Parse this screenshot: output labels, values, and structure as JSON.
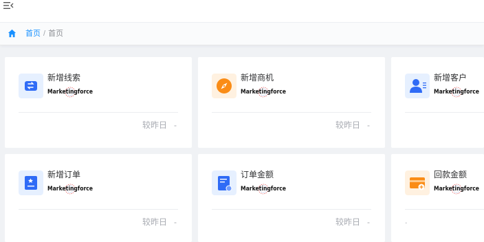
{
  "breadcrumb": {
    "home": "首页",
    "separator": "/",
    "current": "首页"
  },
  "logo_text": "Marketingforce",
  "colors": {
    "accent": "#1890ff",
    "blue_tile": "#e6f0ff",
    "orange_tile": "#fff1e0",
    "orange": "#fa8c16",
    "blue": "#2f6bf6"
  },
  "cards": [
    {
      "title": "新增线索",
      "compare_label": "较昨日",
      "compare_value": "-",
      "icon": "clue-icon"
    },
    {
      "title": "新增商机",
      "compare_label": "较昨日",
      "compare_value": "-",
      "icon": "compass-icon"
    },
    {
      "title": "新增客户",
      "compare_label": "",
      "compare_value": "",
      "icon": "customer-icon"
    },
    {
      "title": "新增订单",
      "compare_label": "较昨日",
      "compare_value": "-",
      "icon": "order-icon"
    },
    {
      "title": "订单金额",
      "compare_label": "较昨日",
      "compare_value": "-",
      "icon": "document-icon"
    },
    {
      "title": "回款金额",
      "compare_label": "",
      "compare_value": ".",
      "icon": "payment-card-icon"
    }
  ]
}
